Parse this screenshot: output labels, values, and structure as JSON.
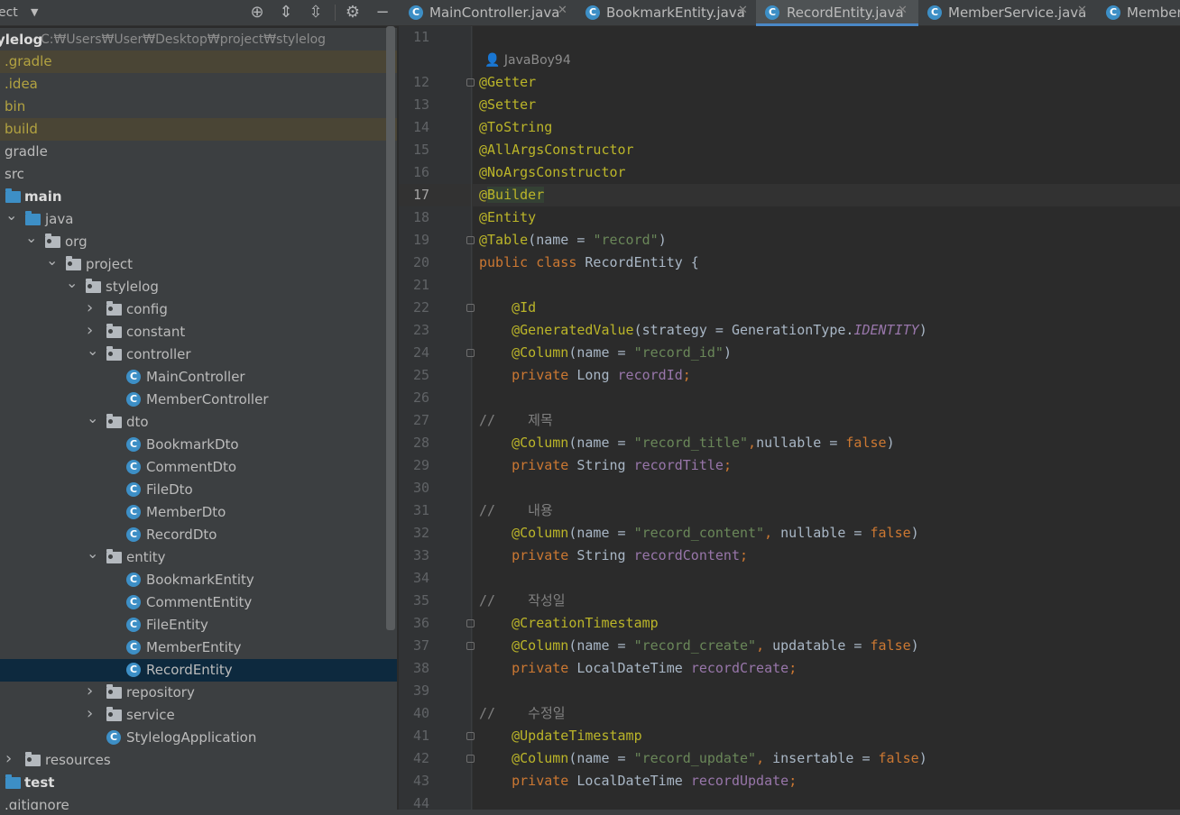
{
  "toolbar": {
    "project_label": "ect",
    "icons": [
      "crosshair-icon",
      "expand-all-icon",
      "collapse-all-icon",
      "gear-icon",
      "minimize-icon"
    ]
  },
  "tabs": [
    {
      "label": "MainController.java",
      "active": false
    },
    {
      "label": "BookmarkEntity.java",
      "active": false
    },
    {
      "label": "RecordEntity.java",
      "active": true
    },
    {
      "label": "MemberService.java",
      "active": false
    },
    {
      "label": "Member",
      "active": false
    }
  ],
  "path_bar": {
    "name": "ylelog",
    "path": "C:₩Users₩User₩Desktop₩project₩stylelog"
  },
  "tree": [
    {
      "label": ".gradle",
      "style": "yel",
      "hl": true
    },
    {
      "label": ".idea",
      "style": "yel"
    },
    {
      "label": "bin",
      "style": "yel"
    },
    {
      "label": "build",
      "style": "yel",
      "hl": true
    },
    {
      "label": "gradle"
    },
    {
      "label": "src"
    },
    {
      "label": "main",
      "style": "bold"
    },
    {
      "label": "java"
    },
    {
      "label": "org"
    },
    {
      "label": "project"
    },
    {
      "label": "stylelog"
    },
    {
      "label": "config"
    },
    {
      "label": "constant"
    },
    {
      "label": "controller"
    },
    {
      "label": "MainController"
    },
    {
      "label": "MemberController"
    },
    {
      "label": "dto"
    },
    {
      "label": "BookmarkDto"
    },
    {
      "label": "CommentDto"
    },
    {
      "label": "FileDto"
    },
    {
      "label": "MemberDto"
    },
    {
      "label": "RecordDto"
    },
    {
      "label": "entity"
    },
    {
      "label": "BookmarkEntity"
    },
    {
      "label": "CommentEntity"
    },
    {
      "label": "FileEntity"
    },
    {
      "label": "MemberEntity"
    },
    {
      "label": "RecordEntity",
      "selected": true
    },
    {
      "label": "repository"
    },
    {
      "label": "service"
    },
    {
      "label": "StylelogApplication"
    },
    {
      "label": "resources"
    },
    {
      "label": "test",
      "style": "bold"
    },
    {
      "label": ".gitignore"
    }
  ],
  "editor": {
    "author": "JavaBoy94",
    "current_line": 17,
    "line_numbers": [
      "11",
      "12",
      "13",
      "14",
      "15",
      "16",
      "17",
      "18",
      "19",
      "20",
      "21",
      "22",
      "23",
      "24",
      "25",
      "26",
      "27",
      "28",
      "29",
      "30",
      "31",
      "32",
      "33",
      "34",
      "35",
      "36",
      "37",
      "38",
      "39",
      "40",
      "41",
      "42",
      "43",
      "44"
    ],
    "lines": [
      {
        "n": "11",
        "t": []
      },
      {
        "n": "12",
        "t": [
          [
            "ann",
            "@Getter"
          ]
        ]
      },
      {
        "n": "13",
        "t": [
          [
            "ann",
            "@Setter"
          ]
        ]
      },
      {
        "n": "14",
        "t": [
          [
            "ann",
            "@ToString"
          ]
        ]
      },
      {
        "n": "15",
        "t": [
          [
            "ann",
            "@AllArgsConstructor"
          ]
        ]
      },
      {
        "n": "16",
        "t": [
          [
            "ann",
            "@NoArgsConstructor"
          ]
        ]
      },
      {
        "n": "17",
        "t": [
          [
            "ann",
            "@"
          ],
          [
            "ann bld",
            "Builder"
          ]
        ]
      },
      {
        "n": "18",
        "t": [
          [
            "ann",
            "@Entity"
          ]
        ]
      },
      {
        "n": "19",
        "t": [
          [
            "ann",
            "@Table"
          ],
          [
            "",
            "(name = "
          ],
          [
            "str",
            "\"record\""
          ],
          [
            "",
            ")"
          ]
        ]
      },
      {
        "n": "20",
        "t": [
          [
            "kw",
            "public class "
          ],
          [
            "",
            "RecordEntity {"
          ]
        ]
      },
      {
        "n": "21",
        "t": []
      },
      {
        "n": "22",
        "t": [
          [
            "",
            "    "
          ],
          [
            "ann",
            "@Id"
          ]
        ]
      },
      {
        "n": "23",
        "t": [
          [
            "",
            "    "
          ],
          [
            "ann",
            "@GeneratedValue"
          ],
          [
            "",
            "(strategy = GenerationType."
          ],
          [
            "ital",
            "IDENTITY"
          ],
          [
            "",
            ")"
          ]
        ]
      },
      {
        "n": "24",
        "t": [
          [
            "",
            "    "
          ],
          [
            "ann",
            "@Column"
          ],
          [
            "",
            "(name = "
          ],
          [
            "str",
            "\"record_id\""
          ],
          [
            "",
            ")"
          ]
        ]
      },
      {
        "n": "25",
        "t": [
          [
            "",
            "    "
          ],
          [
            "kw",
            "private "
          ],
          [
            "",
            "Long "
          ],
          [
            "fld",
            "recordId"
          ],
          [
            "kw",
            ";"
          ]
        ]
      },
      {
        "n": "26",
        "t": []
      },
      {
        "n": "27",
        "t": [
          [
            "cmt",
            "//    제목"
          ]
        ]
      },
      {
        "n": "28",
        "t": [
          [
            "",
            "    "
          ],
          [
            "ann",
            "@Column"
          ],
          [
            "",
            "(name = "
          ],
          [
            "str",
            "\"record_title\""
          ],
          [
            "kw",
            ","
          ],
          [
            "",
            "nullable = "
          ],
          [
            "kw",
            "false"
          ],
          [
            "",
            ")"
          ]
        ]
      },
      {
        "n": "29",
        "t": [
          [
            "",
            "    "
          ],
          [
            "kw",
            "private "
          ],
          [
            "",
            "String "
          ],
          [
            "fld",
            "recordTitle"
          ],
          [
            "kw",
            ";"
          ]
        ]
      },
      {
        "n": "30",
        "t": []
      },
      {
        "n": "31",
        "t": [
          [
            "cmt",
            "//    내용"
          ]
        ]
      },
      {
        "n": "32",
        "t": [
          [
            "",
            "    "
          ],
          [
            "ann",
            "@Column"
          ],
          [
            "",
            "(name = "
          ],
          [
            "str",
            "\"record_content\""
          ],
          [
            "kw",
            ", "
          ],
          [
            "",
            "nullable = "
          ],
          [
            "kw",
            "false"
          ],
          [
            "",
            ")"
          ]
        ]
      },
      {
        "n": "33",
        "t": [
          [
            "",
            "    "
          ],
          [
            "kw",
            "private "
          ],
          [
            "",
            "String "
          ],
          [
            "fld",
            "recordContent"
          ],
          [
            "kw",
            ";"
          ]
        ]
      },
      {
        "n": "34",
        "t": []
      },
      {
        "n": "35",
        "t": [
          [
            "cmt",
            "//    작성일"
          ]
        ]
      },
      {
        "n": "36",
        "t": [
          [
            "",
            "    "
          ],
          [
            "ann",
            "@CreationTimestamp"
          ]
        ]
      },
      {
        "n": "37",
        "t": [
          [
            "",
            "    "
          ],
          [
            "ann",
            "@Column"
          ],
          [
            "",
            "(name = "
          ],
          [
            "str",
            "\"record_create\""
          ],
          [
            "kw",
            ", "
          ],
          [
            "",
            "updatable = "
          ],
          [
            "kw",
            "false"
          ],
          [
            "",
            ")"
          ]
        ]
      },
      {
        "n": "38",
        "t": [
          [
            "",
            "    "
          ],
          [
            "kw",
            "private "
          ],
          [
            "",
            "LocalDateTime "
          ],
          [
            "fld",
            "recordCreate"
          ],
          [
            "kw",
            ";"
          ]
        ]
      },
      {
        "n": "39",
        "t": []
      },
      {
        "n": "40",
        "t": [
          [
            "cmt",
            "//    수정일"
          ]
        ]
      },
      {
        "n": "41",
        "t": [
          [
            "",
            "    "
          ],
          [
            "ann",
            "@UpdateTimestamp"
          ]
        ]
      },
      {
        "n": "42",
        "t": [
          [
            "",
            "    "
          ],
          [
            "ann",
            "@Column"
          ],
          [
            "",
            "(name = "
          ],
          [
            "str",
            "\"record_update\""
          ],
          [
            "kw",
            ", "
          ],
          [
            "",
            "insertable = "
          ],
          [
            "kw",
            "false"
          ],
          [
            "",
            ")"
          ]
        ]
      },
      {
        "n": "43",
        "t": [
          [
            "",
            "    "
          ],
          [
            "kw",
            "private "
          ],
          [
            "",
            "LocalDateTime "
          ],
          [
            "fld",
            "recordUpdate"
          ],
          [
            "kw",
            ";"
          ]
        ]
      },
      {
        "n": "44",
        "t": []
      }
    ]
  }
}
